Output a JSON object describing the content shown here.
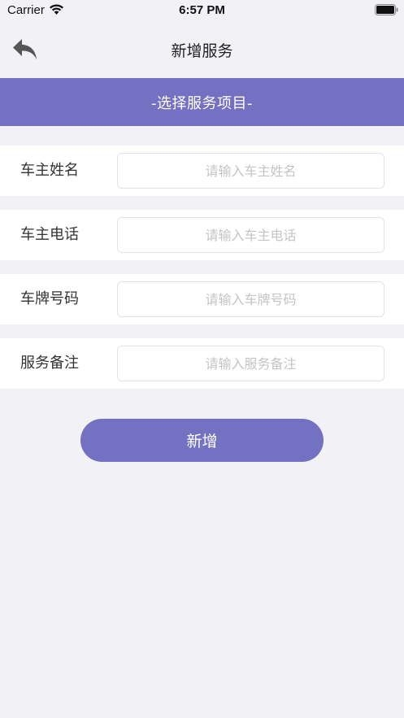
{
  "status_bar": {
    "carrier": "Carrier",
    "time": "6:57 PM"
  },
  "nav": {
    "title": "新增服务",
    "back_icon": "reply-arrow-icon"
  },
  "banner": {
    "label": "-选择服务项目-",
    "color": "#7471c3"
  },
  "form": {
    "rows": [
      {
        "label": "车主姓名",
        "placeholder": "请输入车主姓名",
        "value": ""
      },
      {
        "label": "车主电话",
        "placeholder": "请输入车主电话",
        "value": ""
      },
      {
        "label": "车牌号码",
        "placeholder": "请输入车牌号码",
        "value": ""
      },
      {
        "label": "服务备注",
        "placeholder": "请输入服务备注",
        "value": ""
      }
    ]
  },
  "submit": {
    "label": "新增"
  },
  "colors": {
    "accent": "#7471c3",
    "background": "#f2f1f6"
  }
}
